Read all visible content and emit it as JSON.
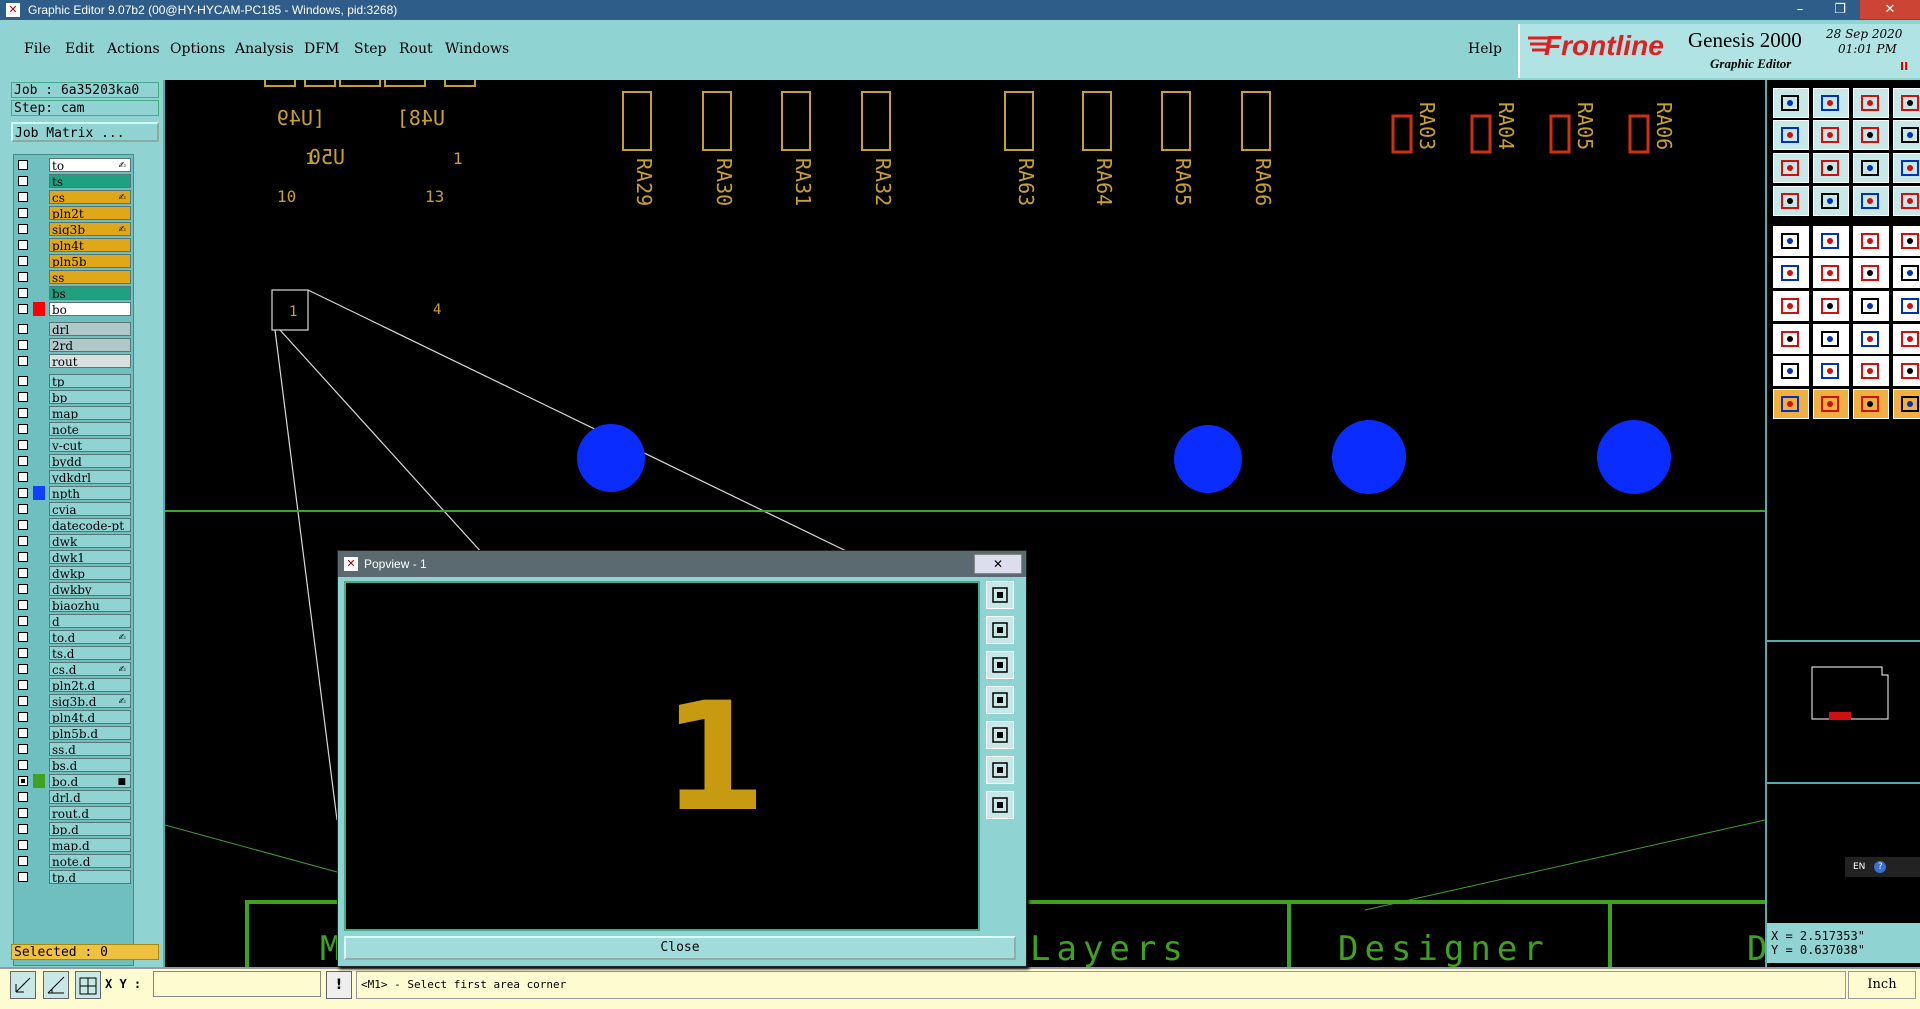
{
  "window": {
    "title": "Graphic Editor 9.07b2 (00@HY-HYCAM-PC185 - Windows, pid:3268)",
    "min": "–",
    "max": "❐",
    "close": "✕"
  },
  "menu": {
    "file": "File",
    "edit": "Edit",
    "actions": "Actions",
    "options": "Options",
    "analysis": "Analysis",
    "dfm": "DFM",
    "step": "Step",
    "rout": "Rout",
    "windows": "Windows",
    "help": "Help"
  },
  "brand": {
    "logo": "Frontline",
    "product": "Genesis 2000",
    "subtitle": "Graphic Editor",
    "date": "28 Sep 2020",
    "time": "01:01 PM"
  },
  "left": {
    "job": "Job : 6a35203ka0",
    "step": "Step: cam",
    "job_matrix": "Job Matrix ...",
    "selected": "Selected : 0"
  },
  "layers": [
    {
      "name": "to",
      "color": "#ffffff",
      "mark": "✍"
    },
    {
      "name": "ts",
      "color": "#20a080"
    },
    {
      "name": "cs",
      "color": "#e0a818",
      "mark": "✍"
    },
    {
      "name": "pln2t",
      "color": "#e0a818"
    },
    {
      "name": "sig3b",
      "color": "#e0a818",
      "mark": "✍"
    },
    {
      "name": "pln4t",
      "color": "#e0a818"
    },
    {
      "name": "pln5b",
      "color": "#e0a818"
    },
    {
      "name": "ss",
      "color": "#e0a818"
    },
    {
      "name": "bs",
      "color": "#20a080"
    },
    {
      "name": "bo",
      "color": "#ffffff",
      "swatch": "#ff0000"
    },
    {
      "name": "drl",
      "color": "#b0c8c8"
    },
    {
      "name": "2rd",
      "color": "#b0c8c8"
    },
    {
      "name": "rout",
      "color": "#d8e0e0"
    },
    {
      "name": "tp",
      "color": "#8fd3d3"
    },
    {
      "name": "bp",
      "color": "#8fd3d3"
    },
    {
      "name": "map",
      "color": "#8fd3d3"
    },
    {
      "name": "note",
      "color": "#8fd3d3"
    },
    {
      "name": "v-cut",
      "color": "#8fd3d3"
    },
    {
      "name": "bydd",
      "color": "#8fd3d3"
    },
    {
      "name": "ydkdrl",
      "color": "#8fd3d3"
    },
    {
      "name": "npth",
      "color": "#8fd3d3",
      "swatch": "#1040ff"
    },
    {
      "name": "cvia",
      "color": "#8fd3d3"
    },
    {
      "name": "datecode-pt",
      "color": "#8fd3d3"
    },
    {
      "name": "dwk",
      "color": "#8fd3d3"
    },
    {
      "name": "dwk1",
      "color": "#8fd3d3"
    },
    {
      "name": "dwkp",
      "color": "#8fd3d3"
    },
    {
      "name": "dwkby",
      "color": "#8fd3d3"
    },
    {
      "name": "biaozhu",
      "color": "#8fd3d3"
    },
    {
      "name": "d",
      "color": "#8fd3d3"
    },
    {
      "name": "to.d",
      "color": "#8fd3d3",
      "mark": "✍"
    },
    {
      "name": "ts.d",
      "color": "#8fd3d3"
    },
    {
      "name": "cs.d",
      "color": "#8fd3d3",
      "mark": "✍"
    },
    {
      "name": "pln2t.d",
      "color": "#8fd3d3"
    },
    {
      "name": "sig3b.d",
      "color": "#8fd3d3",
      "mark": "✍"
    },
    {
      "name": "pln4t.d",
      "color": "#8fd3d3"
    },
    {
      "name": "pln5b.d",
      "color": "#8fd3d3"
    },
    {
      "name": "ss.d",
      "color": "#8fd3d3"
    },
    {
      "name": "bs.d",
      "color": "#8fd3d3"
    },
    {
      "name": "bo.d",
      "color": "#8fd3d3",
      "swatch": "#40a020",
      "checked": true,
      "mark": "■"
    },
    {
      "name": "drl.d",
      "color": "#8fd3d3"
    },
    {
      "name": "rout.d",
      "color": "#8fd3d3"
    },
    {
      "name": "bp.d",
      "color": "#8fd3d3"
    },
    {
      "name": "map.d",
      "color": "#8fd3d3"
    },
    {
      "name": "note.d",
      "color": "#8fd3d3"
    },
    {
      "name": "tp.d",
      "color": "#8fd3d3"
    }
  ],
  "canvas": {
    "top_labels": {
      "u49": "[U49",
      "u48": "U48]",
      "u50": "U50",
      "one_a": "1",
      "one_b": "1",
      "ten": "10",
      "thirteen": "13",
      "box_label": "1",
      "four": "4"
    },
    "refdes": [
      "RA29",
      "RA30",
      "RA31",
      "RA32",
      "RA63",
      "RA64",
      "RA65",
      "RA66"
    ],
    "red_refdes": [
      "RA03",
      "RA04",
      "RA05",
      "RA06"
    ],
    "bottom": {
      "layers": "Layers",
      "designer": "Designer",
      "m": "M",
      "d": "D"
    }
  },
  "popup": {
    "title": "Popview - 1",
    "close_x": "✕",
    "content": "1",
    "close": "Close"
  },
  "right": {
    "lang": "EN",
    "x": "X = 2.517353\"",
    "y": "Y = 0.637038\""
  },
  "status": {
    "xy_label": "X Y :",
    "xy_value": "",
    "message": "<M1> - Select first area corner",
    "units": "Inch"
  }
}
